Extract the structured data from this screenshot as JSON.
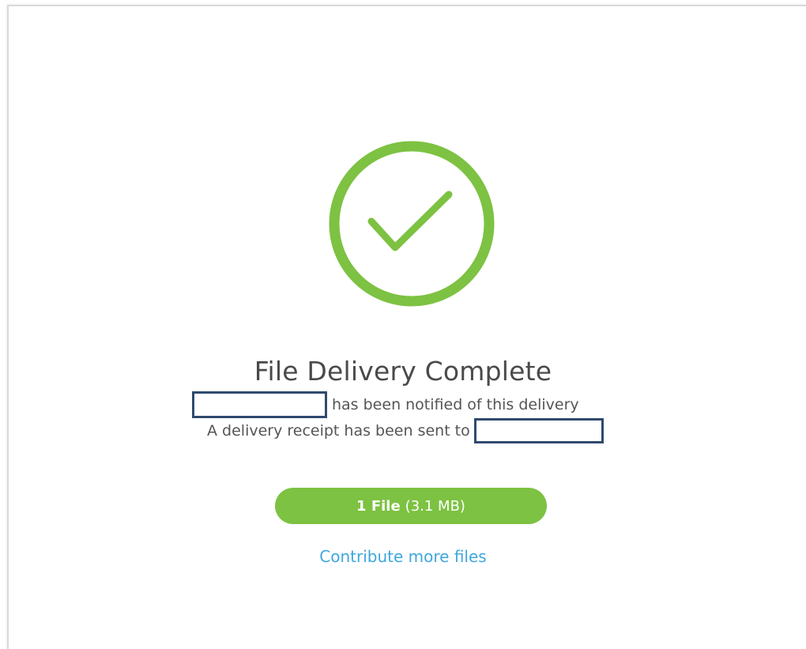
{
  "status": {
    "icon": "checkmark-circle-icon",
    "accent_color": "#7dc242",
    "title": "File Delivery Complete",
    "notified_text": "has been notified of this delivery",
    "receipt_text": "A delivery receipt has been sent to"
  },
  "files_button": {
    "count_label": "1 File",
    "size_label": "(3.1 MB)"
  },
  "contribute_link": {
    "label": "Contribute more files",
    "color": "#3fa7dc"
  }
}
